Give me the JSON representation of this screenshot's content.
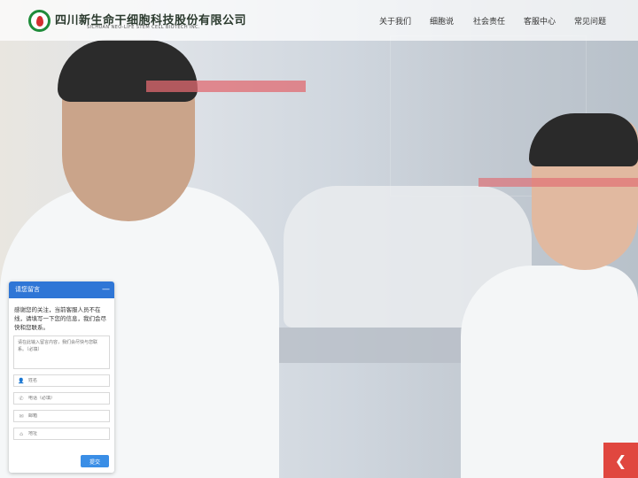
{
  "header": {
    "brand_cn": "四川新生命干细胞科技股份有限公司",
    "brand_en": "SICHUAN NEO-LIFE STEM CELL BIOTECH INC."
  },
  "nav": {
    "items": [
      {
        "label": "关于我们"
      },
      {
        "label": "细胞说"
      },
      {
        "label": "社会责任"
      },
      {
        "label": "客服中心"
      },
      {
        "label": "常见问题"
      }
    ]
  },
  "message_panel": {
    "title": "请您留言",
    "minimize": "—",
    "intro": "感谢您的关注，当前客服人员不在线，请填写一下您的信息，我们会尽快和您联系。",
    "textarea_placeholder": "请在此输入留言内容，我们会尽快与您联系。（必填）",
    "fields": [
      {
        "icon": "person-icon",
        "placeholder": "姓名"
      },
      {
        "icon": "phone-icon",
        "placeholder": "电话（必填）"
      },
      {
        "icon": "email-icon",
        "placeholder": "邮箱"
      },
      {
        "icon": "location-icon",
        "placeholder": "地址"
      }
    ],
    "submit": "提交"
  },
  "float_button": {
    "icon": "chevron-left-icon",
    "glyph": "❮"
  },
  "colors": {
    "accent": "#2f76d6",
    "brand_green": "#1f8c3a",
    "float_red": "#e0473f"
  }
}
